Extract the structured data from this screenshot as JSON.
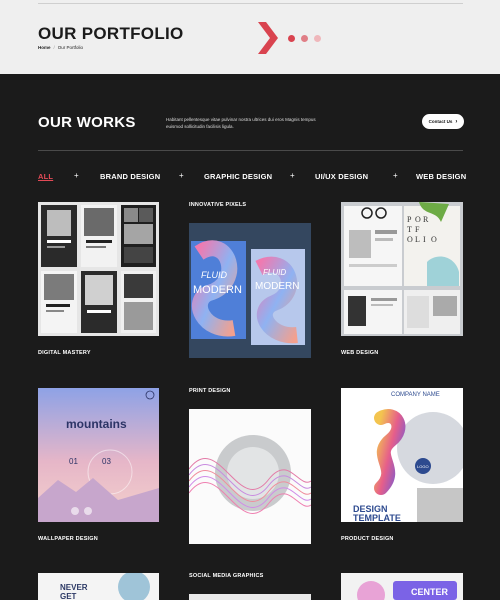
{
  "header": {
    "title": "OUR PORTFOLIO",
    "breadcrumb": {
      "home": "Home",
      "separator": "/",
      "current": "Our Portfolio"
    },
    "accent_color": "#d9434f"
  },
  "works": {
    "title": "OUR WORKS",
    "description": "Habitant pellentesque vitae pulvinar nostra ultrices dui eros Magnis tempus euismod sollicitudin facilisis ligula.",
    "contact_label": "Contact Us"
  },
  "filters": [
    "ALL",
    "BRAND DESIGN",
    "GRAPHIC DESIGN",
    "UI/UX DESIGN",
    "WEB DESIGN"
  ],
  "filter_separator": "+",
  "active_filter": "ALL",
  "portfolio": [
    {
      "title": "DIGITAL MASTERY"
    },
    {
      "title": "INNOVATIVE PIXELS",
      "image_text": {
        "word1": "FLUID",
        "word2": "MODERN"
      }
    },
    {
      "title": "WEB DESIGN",
      "image_text": {
        "letters": [
          "P",
          "O",
          "R",
          "T",
          "F",
          "O",
          "L",
          "I",
          "O"
        ]
      }
    },
    {
      "title": "WALLPAPER DESIGN",
      "image_text": {
        "heading": "mountains",
        "num1": "01",
        "num2": "03"
      }
    },
    {
      "title": "PRINT DESIGN"
    },
    {
      "title": "PRODUCT DESIGN",
      "image_text": {
        "company": "COMPANY NAME",
        "line1": "DESIGN",
        "line2": "TEMPLATE",
        "badge": "LOGO"
      }
    },
    {
      "title": "SOCIAL MEDIA GRAPHICS"
    },
    {
      "image_text": {
        "line1": "NEVER",
        "line2": "GET"
      }
    },
    {
      "image_text": {
        "word": "CENTER"
      }
    }
  ]
}
